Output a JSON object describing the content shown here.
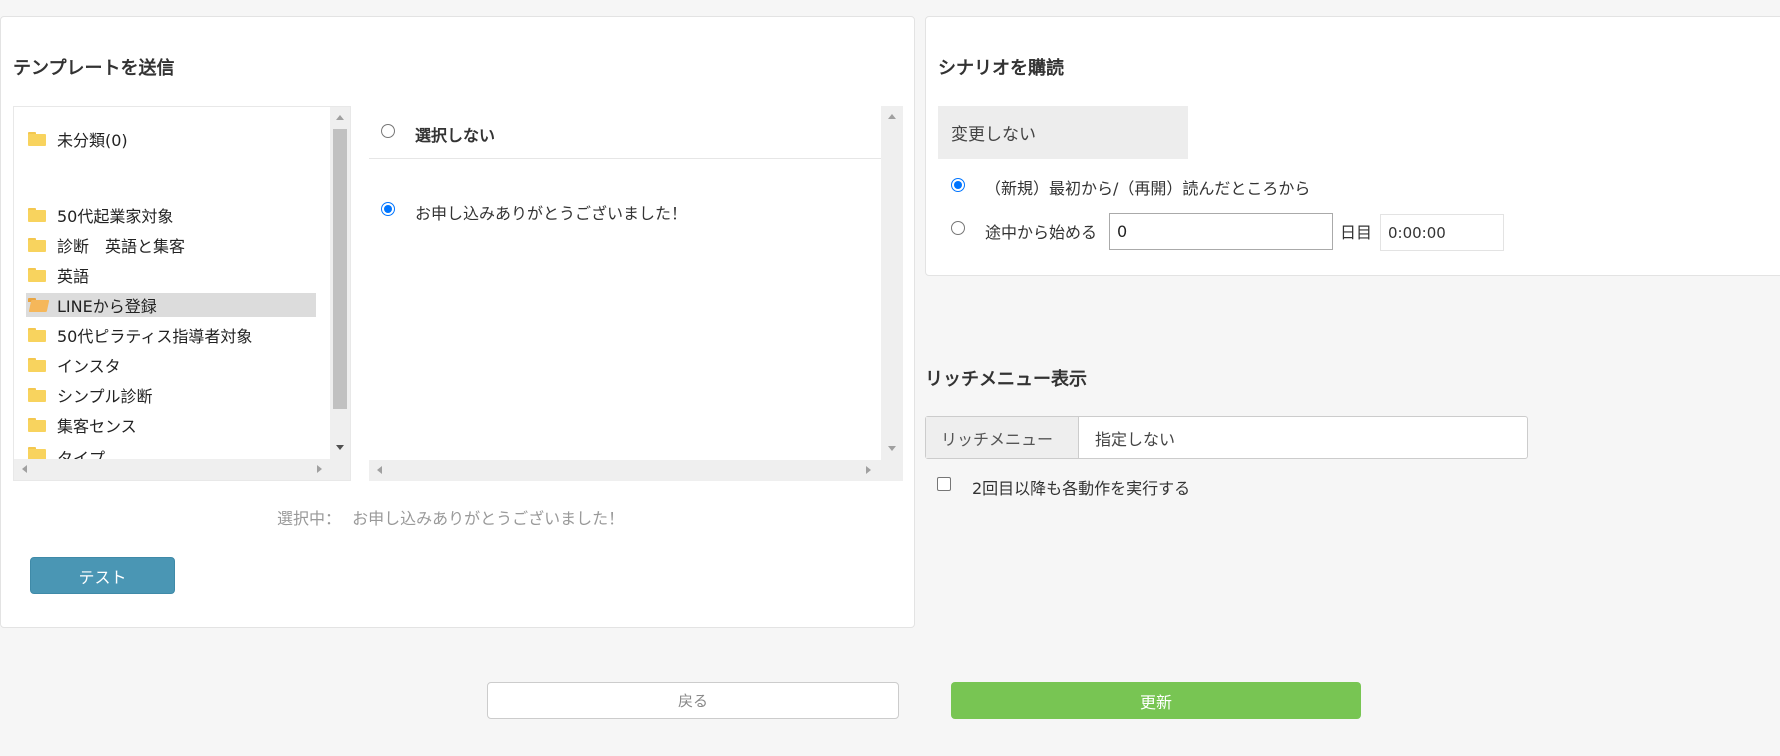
{
  "template_panel": {
    "title": "テンプレートを送信",
    "folders": [
      {
        "label": "未分類(0)"
      },
      {
        "label": "50代起業家対象"
      },
      {
        "label": "診断　英語と集客"
      },
      {
        "label": "英語"
      },
      {
        "label": "LINEから登録"
      },
      {
        "label": "50代ピラティス指導者対象"
      },
      {
        "label": "インスタ"
      },
      {
        "label": "シンプル診断"
      },
      {
        "label": "集客センス"
      },
      {
        "label": "タイプ"
      }
    ],
    "options": {
      "none_label": "選択しない",
      "template_label": "お申し込みありがとうございました！"
    },
    "selected_prefix": "選択中：",
    "selected_value": "お申し込みありがとうございました！",
    "test_button": "テスト"
  },
  "scenario_panel": {
    "title": "シナリオを購読",
    "select_value": "変更しない",
    "option_start": "（新規）最初から/（再開）読んだところから",
    "option_middle": "途中から始める",
    "day_value": "0",
    "day_unit": "日目",
    "time_value": "0:00:00"
  },
  "rich_menu": {
    "title": "リッチメニュー表示",
    "label": "リッチメニュー",
    "value": "指定しない",
    "checkbox_label": "2回目以降も各動作を実行する"
  },
  "footer": {
    "back_button": "戻る",
    "update_button": "更新"
  },
  "colors": {
    "test_button": "#4a96b4",
    "update_button": "#78c553",
    "radio_checked": "#0075ff"
  }
}
